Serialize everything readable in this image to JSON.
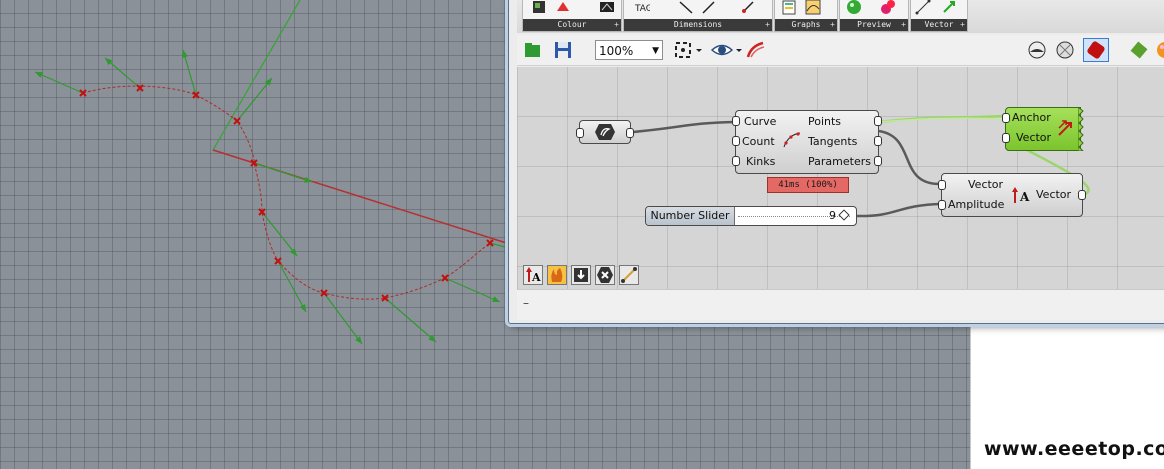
{
  "ribbon": {
    "groups": [
      {
        "label": "Colour"
      },
      {
        "label": "Dimensions"
      },
      {
        "label": "Graphs"
      },
      {
        "label": "Preview"
      },
      {
        "label": "Vector"
      }
    ],
    "plus": "+"
  },
  "toolbar": {
    "zoom": "100%"
  },
  "canvas": {
    "divide": {
      "inputs": [
        "Curve",
        "Count",
        "Kinks"
      ],
      "outputs": [
        "Points",
        "Tangents",
        "Parameters"
      ],
      "timer": "41ms (100%)"
    },
    "slider": {
      "label": "Number Slider",
      "value": "9"
    },
    "vector_comp": {
      "inputs": [
        "Vector",
        "Amplitude"
      ],
      "output": "Vector"
    },
    "vector_preview": {
      "inputs": [
        "Anchor",
        "Vector"
      ]
    }
  },
  "footer": {
    "dash": "–"
  },
  "watermark": "www.eeeetop.com",
  "colors": {
    "curve": "#b02a2a",
    "arrow": "#2f9a2f",
    "timer": "#e46863",
    "preview_green": "#8fd444",
    "window_border": "#5b6f86"
  }
}
